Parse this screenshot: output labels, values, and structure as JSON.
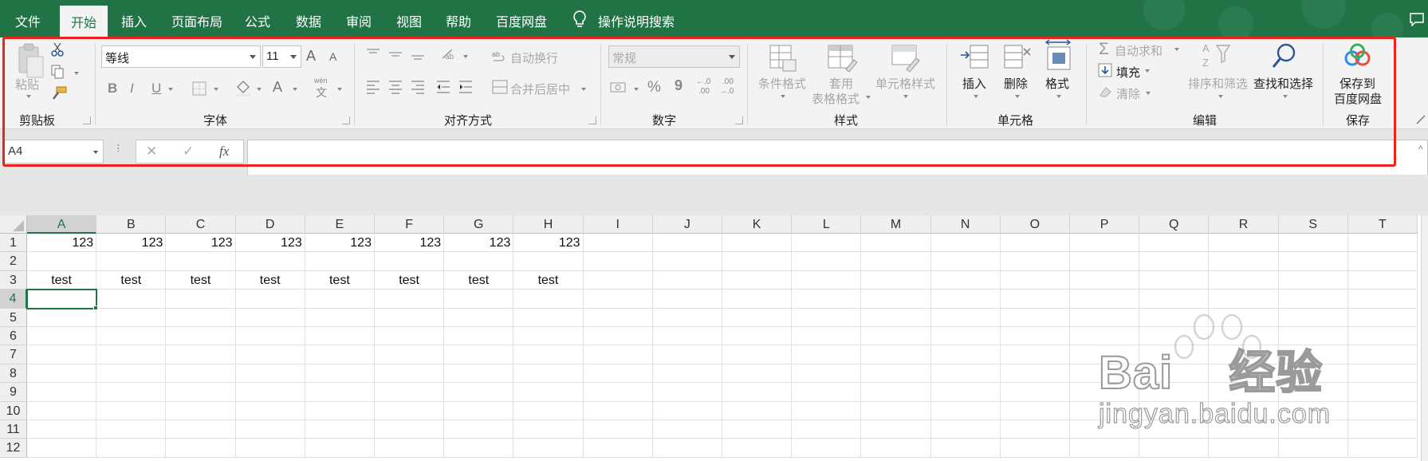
{
  "menu": {
    "tabs": [
      "文件",
      "开始",
      "插入",
      "页面布局",
      "公式",
      "数据",
      "审阅",
      "视图",
      "帮助",
      "百度网盘"
    ],
    "active_tab": "开始",
    "search_label": "操作说明搜索"
  },
  "ribbon": {
    "clipboard": {
      "paste": "粘贴",
      "group": "剪贴板"
    },
    "font": {
      "name": "等线",
      "size": "11",
      "grow": "A",
      "shrink": "A",
      "bold": "B",
      "italic": "I",
      "underline": "U",
      "phonetic_top": "wén",
      "phonetic_bottom": "文",
      "color_a": "A",
      "group": "字体"
    },
    "alignment": {
      "wrap": "自动换行",
      "merge": "合并后居中",
      "group": "对齐方式"
    },
    "number": {
      "format": "常规",
      "percent": "%",
      "comma": "9",
      "inc_top": "←.0",
      "inc_bottom": ".00",
      "dec_top": ".00",
      "dec_bottom": "→.0",
      "group": "数字"
    },
    "styles": {
      "conditional": "条件格式",
      "table_format_1": "套用",
      "table_format_2": "表格格式",
      "cell_styles": "单元格样式",
      "group": "样式"
    },
    "cells": {
      "insert": "插入",
      "delete": "删除",
      "format": "格式",
      "group": "单元格"
    },
    "editing": {
      "autosum": "自动求和",
      "fill": "填充",
      "clear": "清除",
      "sort": "排序和筛选",
      "find": "查找和选择",
      "group": "编辑"
    },
    "save": {
      "label_1": "保存到",
      "label_2": "百度网盘",
      "group": "保存"
    }
  },
  "formula_bar": {
    "name_box": "A4",
    "fx": "fx",
    "cancel": "✕",
    "enter": "✓",
    "content": ""
  },
  "sheet": {
    "columns": [
      "A",
      "B",
      "C",
      "D",
      "E",
      "F",
      "G",
      "H",
      "I",
      "J",
      "K",
      "L",
      "M",
      "N",
      "O",
      "P",
      "Q",
      "R",
      "S",
      "T"
    ],
    "rows": [
      "1",
      "2",
      "3",
      "4",
      "5",
      "6",
      "7",
      "8",
      "9",
      "10",
      "11",
      "12"
    ],
    "selected_cell": "A4",
    "cells": {
      "row1": [
        "123",
        "123",
        "123",
        "123",
        "123",
        "123",
        "123",
        "123"
      ],
      "row3": [
        "test",
        "test",
        "test",
        "test",
        "test",
        "test",
        "test",
        "test"
      ]
    }
  },
  "watermark": {
    "brand": "Bai",
    "brand2": "经验",
    "domain": "jingyan.baidu.com"
  },
  "colors": {
    "accent": "#217346",
    "highlight_box": "#e8251d"
  }
}
